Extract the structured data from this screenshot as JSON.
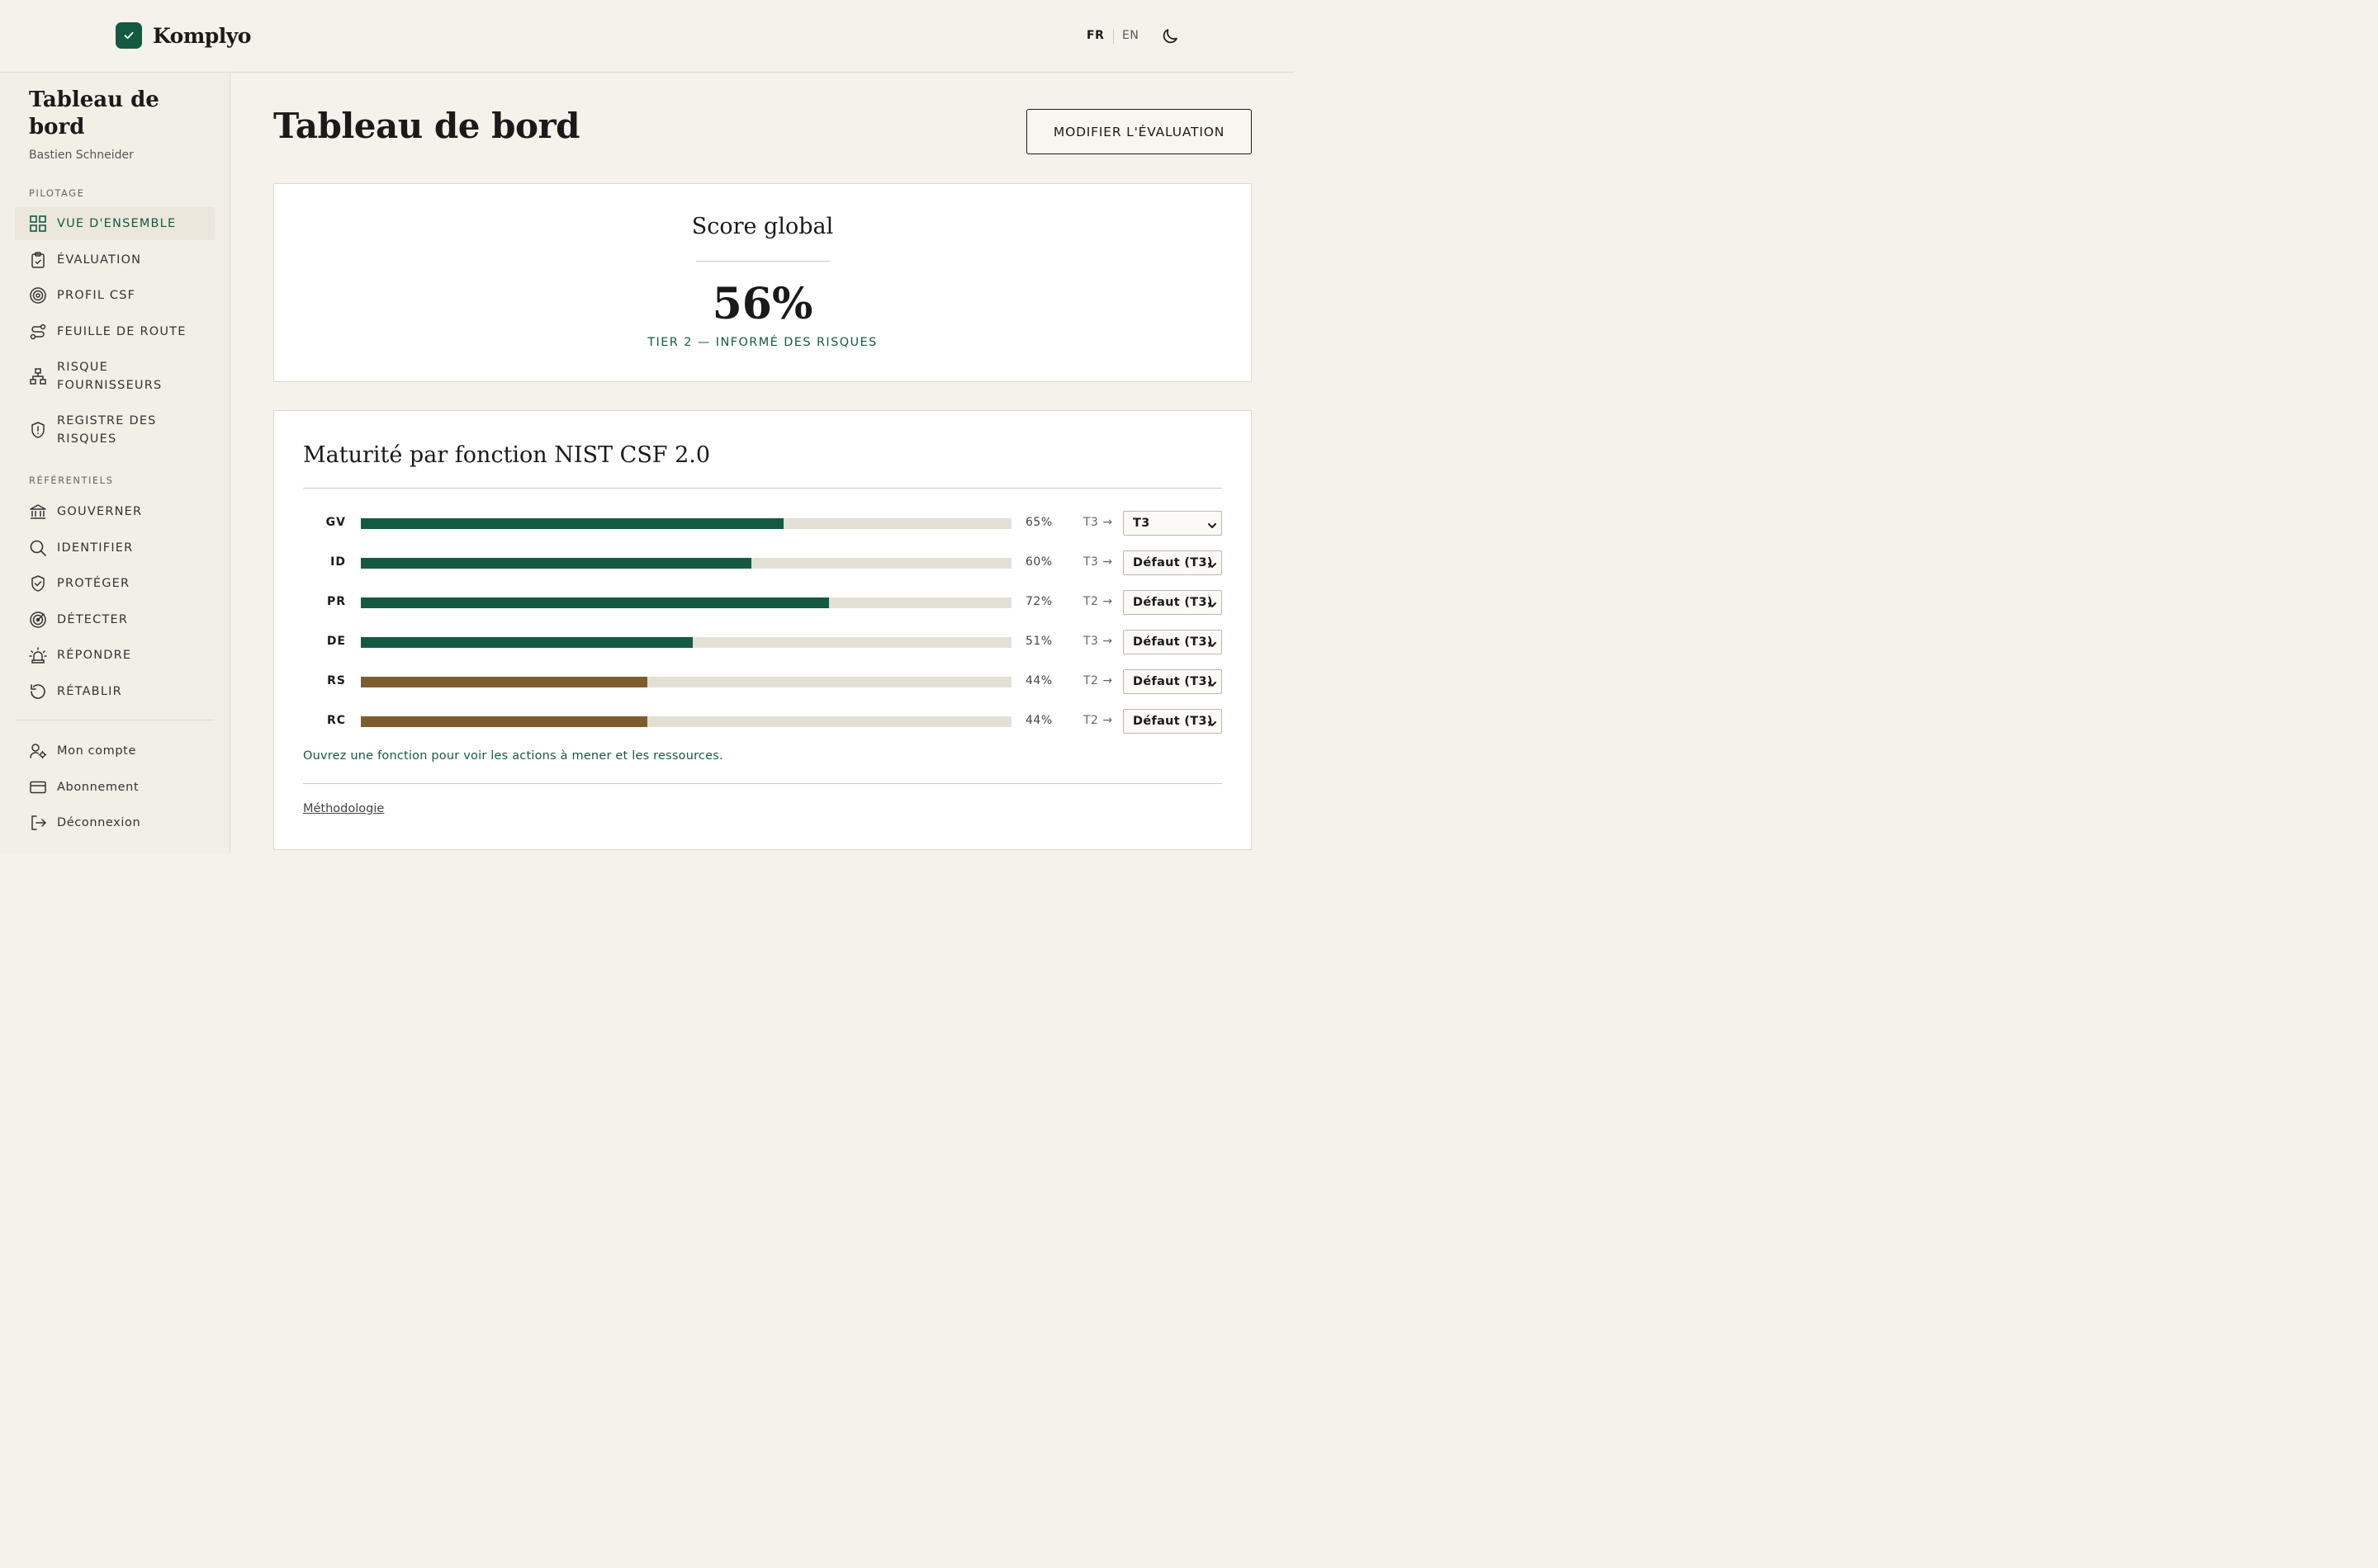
{
  "header": {
    "brand": "Komplyo",
    "lang_fr": "FR",
    "lang_en": "EN",
    "theme_icon": "moon-icon"
  },
  "sidebar": {
    "title": "Tableau de bord",
    "user": "Bastien Schneider",
    "section_pilotage": "PILOTAGE",
    "pilotage": [
      {
        "label": "VUE D'ENSEMBLE",
        "icon": "grid-icon",
        "active": true
      },
      {
        "label": "ÉVALUATION",
        "icon": "clipboard-check-icon"
      },
      {
        "label": "PROFIL CSF",
        "icon": "target-icon"
      },
      {
        "label": "FEUILLE DE ROUTE",
        "icon": "route-icon"
      },
      {
        "label": "RISQUE FOURNISSEURS",
        "icon": "network-icon"
      },
      {
        "label": "REGISTRE DES RISQUES",
        "icon": "shield-alert-icon"
      }
    ],
    "section_referentiels": "RÉFÉRENTIELS",
    "referentiels": [
      {
        "label": "GOUVERNER",
        "icon": "landmark-icon"
      },
      {
        "label": "IDENTIFIER",
        "icon": "search-icon"
      },
      {
        "label": "PROTÉGER",
        "icon": "shield-check-icon"
      },
      {
        "label": "DÉTECTER",
        "icon": "radar-icon"
      },
      {
        "label": "RÉPONDRE",
        "icon": "siren-icon"
      },
      {
        "label": "RÉTABLIR",
        "icon": "rotate-ccw-icon"
      }
    ],
    "account": [
      {
        "label": "Mon compte",
        "icon": "user-cog-icon"
      },
      {
        "label": "Abonnement",
        "icon": "credit-card-icon"
      },
      {
        "label": "Déconnexion",
        "icon": "log-out-icon"
      }
    ]
  },
  "main": {
    "title": "Tableau de bord",
    "edit_button": "MODIFIER L'ÉVALUATION",
    "score": {
      "title": "Score global",
      "value": "56%",
      "tier": "TIER 2 — INFORMÉ DES RISQUES"
    },
    "maturity": {
      "title": "Maturité par fonction NIST CSF 2.0",
      "rows": [
        {
          "code": "GV",
          "value": 65,
          "pct": "65%",
          "tier": "T3 →",
          "select": "T3",
          "status": "ok"
        },
        {
          "code": "ID",
          "value": 60,
          "pct": "60%",
          "tier": "T3 →",
          "select": "Défaut (T3)",
          "status": "ok"
        },
        {
          "code": "PR",
          "value": 72,
          "pct": "72%",
          "tier": "T2 →",
          "select": "Défaut (T3)",
          "status": "ok"
        },
        {
          "code": "DE",
          "value": 51,
          "pct": "51%",
          "tier": "T3 →",
          "select": "Défaut (T3)",
          "status": "ok"
        },
        {
          "code": "RS",
          "value": 44,
          "pct": "44%",
          "tier": "T2 →",
          "select": "Défaut (T3)",
          "status": "warn"
        },
        {
          "code": "RC",
          "value": 44,
          "pct": "44%",
          "tier": "T2 →",
          "select": "Défaut (T3)",
          "status": "warn"
        }
      ],
      "hint": "Ouvrez une fonction pour voir les actions à mener et les ressources.",
      "methodology": "Méthodologie"
    }
  },
  "colors": {
    "accent": "#145a43",
    "warn": "#7d5d2e",
    "track": "#e3e0d6"
  }
}
